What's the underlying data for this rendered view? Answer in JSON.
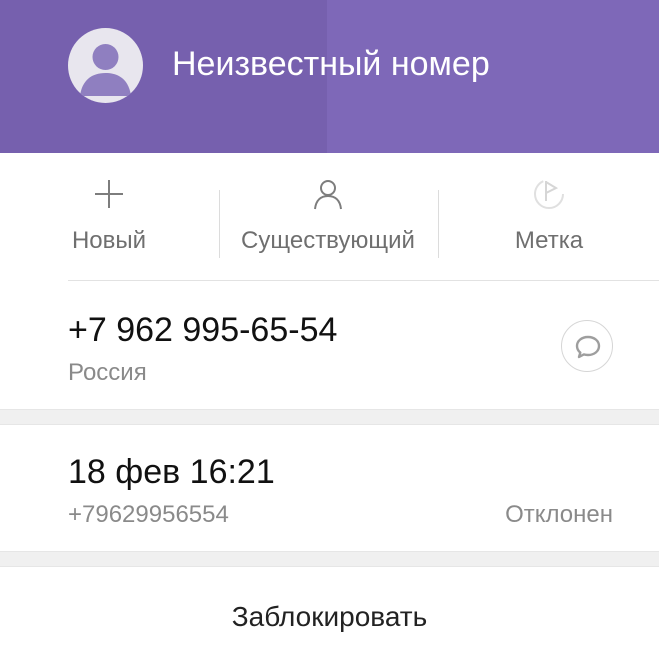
{
  "header": {
    "title": "Неизвестный номер",
    "avatar_icon": "person-icon",
    "colors": {
      "background": "#7e68b8",
      "shade": "#7660ae",
      "text": "#ffffff"
    }
  },
  "actions": [
    {
      "label": "Новый",
      "icon": "plus-icon"
    },
    {
      "label": "Существующий",
      "icon": "person-outline-icon"
    },
    {
      "label": "Метка",
      "icon": "flag-icon"
    }
  ],
  "contact": {
    "phone": "+7 962 995-65-54",
    "country": "Россия",
    "message_icon": "message-bubble-icon"
  },
  "call_log": {
    "datetime": "18 фев 16:21",
    "number": "+79629956554",
    "status": "Отклонен"
  },
  "block": {
    "label": "Заблокировать"
  }
}
